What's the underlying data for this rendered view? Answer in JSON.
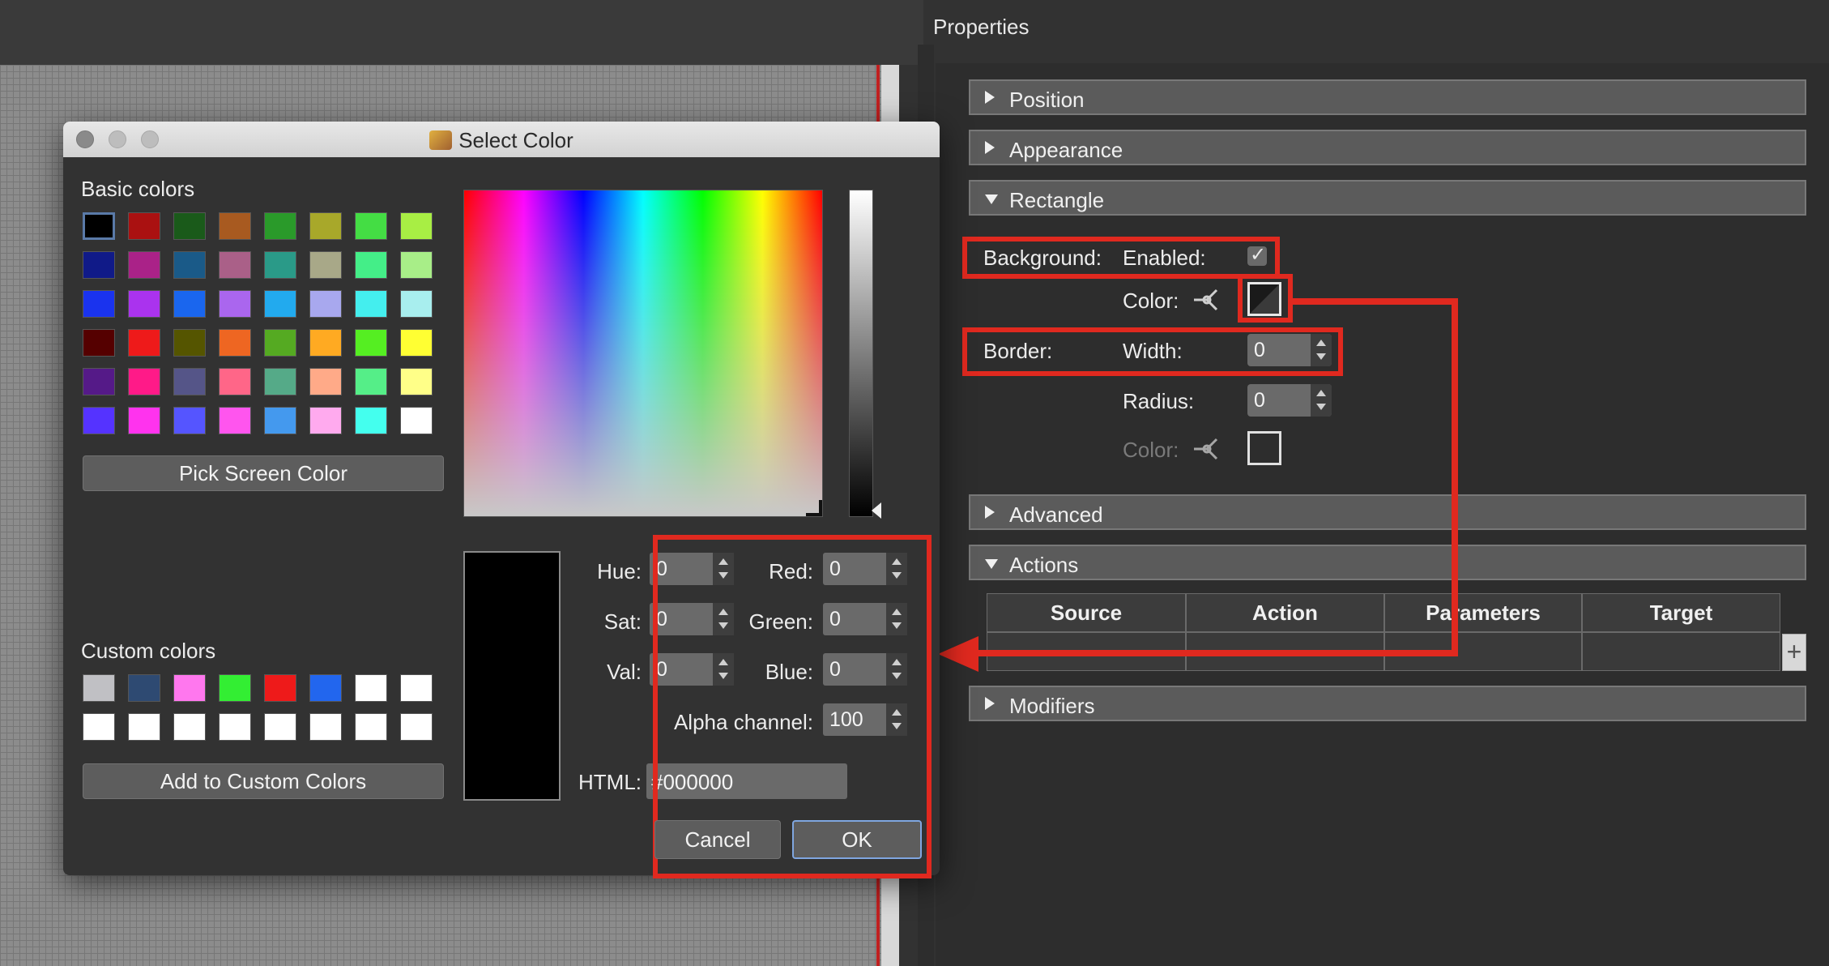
{
  "properties": {
    "title": "Properties",
    "sections": {
      "position": "Position",
      "appearance": "Appearance",
      "rectangle": "Rectangle",
      "advanced": "Advanced",
      "actions": "Actions",
      "modifiers": "Modifiers"
    },
    "rectangle": {
      "background_label": "Background:",
      "enabled_label": "Enabled:",
      "enabled_checked": true,
      "color_label": "Color:",
      "border_label": "Border:",
      "width_label": "Width:",
      "width_value": "0",
      "radius_label": "Radius:",
      "radius_value": "0",
      "border_color_label": "Color:"
    },
    "actions_table": {
      "columns": [
        "Source",
        "Action",
        "Parameters",
        "Target"
      ],
      "add_button": "+"
    }
  },
  "dialog": {
    "title": "Select Color",
    "basic_colors_label": "Basic colors",
    "basic_colors": [
      "#000000",
      "#aa1111",
      "#1a5a1a",
      "#a85a20",
      "#2a9a2a",
      "#a8a82a",
      "#44dd44",
      "#a8ee44",
      "#101a88",
      "#aa2288",
      "#1a5a88",
      "#aa6088",
      "#2a9a88",
      "#a8a888",
      "#44ee88",
      "#a8ee88",
      "#1a33ee",
      "#aa33ee",
      "#1a66ee",
      "#aa66ee",
      "#22aaee",
      "#a8a8ee",
      "#44eeee",
      "#a8eeee",
      "#550000",
      "#ee1a1a",
      "#555500",
      "#ee6622",
      "#55aa22",
      "#ffaa22",
      "#55ee22",
      "#ffff33",
      "#551a88",
      "#ff1a88",
      "#555588",
      "#ff6688",
      "#55aa88",
      "#ffaa88",
      "#55ee88",
      "#ffff88",
      "#5533ff",
      "#ff33ee",
      "#5555ff",
      "#ff55ee",
      "#4499ee",
      "#ffaaee",
      "#44ffee",
      "#ffffff"
    ],
    "pick_screen_color": "Pick Screen Color",
    "custom_colors_label": "Custom colors",
    "custom_colors": [
      "#c0c0c4",
      "#2e4a72",
      "#ff77ee",
      "#33ee33",
      "#ee1a1a",
      "#2266ee",
      "#ffffff",
      "#ffffff",
      "#ffffff",
      "#ffffff",
      "#ffffff",
      "#ffffff",
      "#ffffff",
      "#ffffff",
      "#ffffff",
      "#ffffff"
    ],
    "add_to_custom": "Add to Custom Colors",
    "fields": {
      "hue_label": "Hue:",
      "hue_value": "0",
      "sat_label": "Sat:",
      "sat_value": "0",
      "val_label": "Val:",
      "val_value": "0",
      "red_label": "Red:",
      "red_value": "0",
      "green_label": "Green:",
      "green_value": "0",
      "blue_label": "Blue:",
      "blue_value": "0",
      "alpha_label": "Alpha channel:",
      "alpha_value": "100",
      "html_label": "HTML:",
      "html_value": "#000000"
    },
    "cancel": "Cancel",
    "ok": "OK",
    "current_color": "#000000"
  }
}
